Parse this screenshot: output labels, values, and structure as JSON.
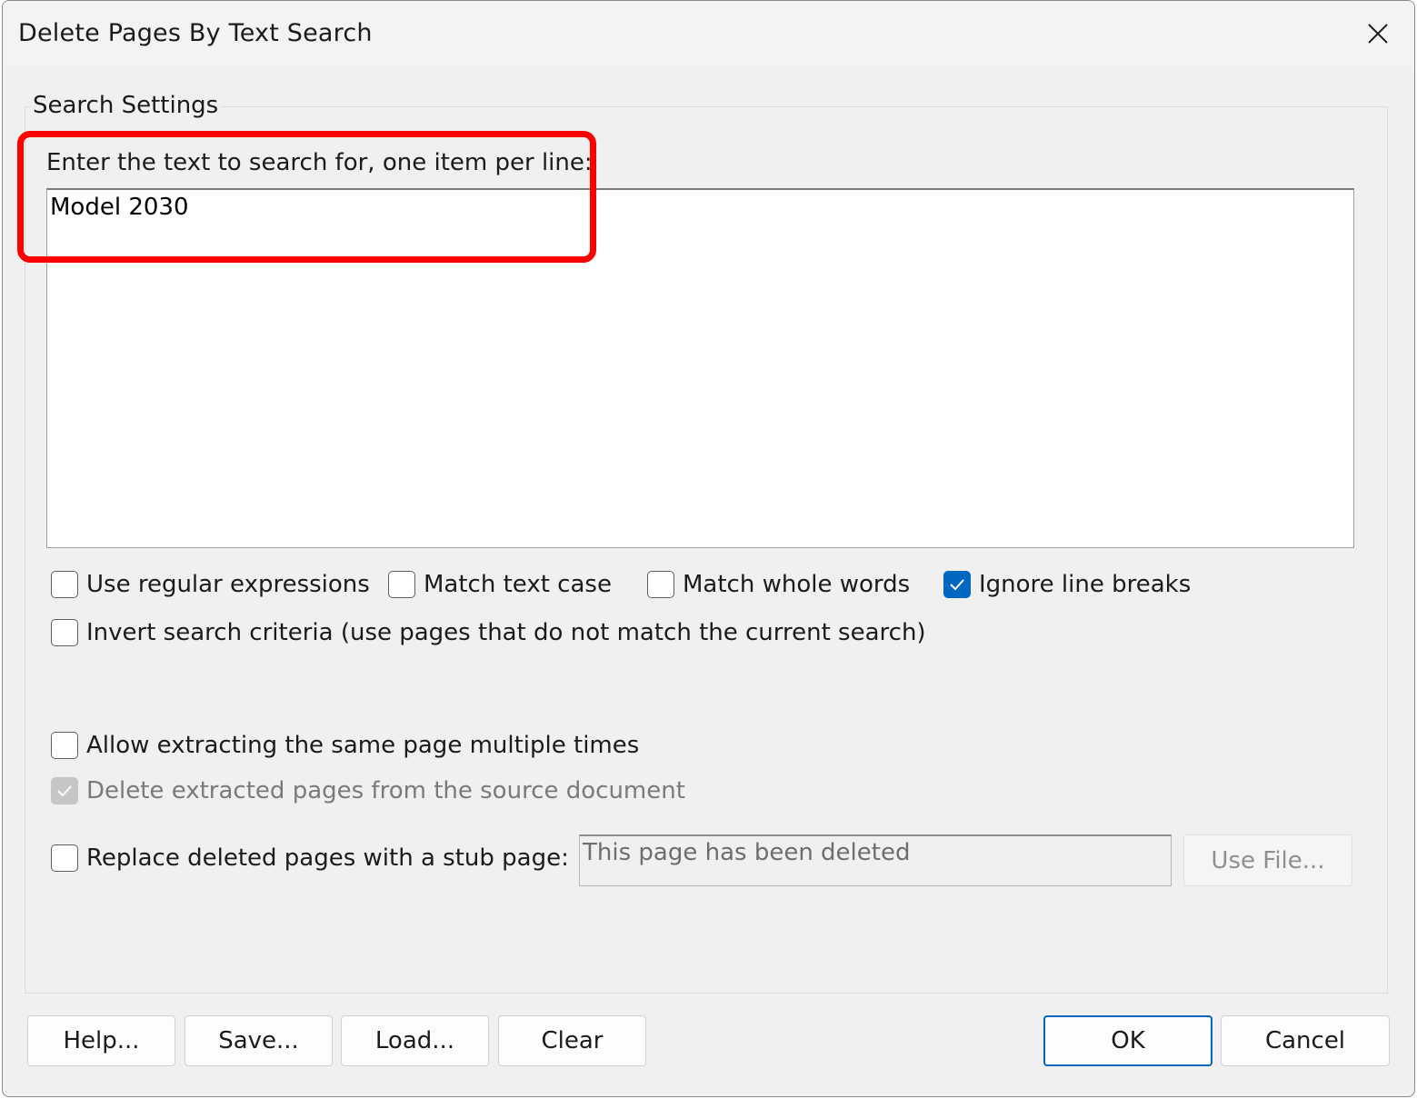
{
  "window": {
    "title": "Delete Pages By Text Search"
  },
  "search_settings": {
    "group_label": "Search Settings",
    "prompt": "Enter the text to search for, one item per line:",
    "search_text": "Model 2030"
  },
  "options": {
    "use_regex": {
      "label": "Use regular expressions",
      "checked": false
    },
    "match_case": {
      "label": "Match text case",
      "checked": false
    },
    "whole_words": {
      "label": "Match whole words",
      "checked": false
    },
    "ignore_line_breaks": {
      "label": "Ignore line breaks",
      "checked": true
    },
    "invert": {
      "label": "Invert search criteria (use pages that do not match the current search)",
      "checked": false
    },
    "allow_multiple": {
      "label": "Allow extracting the same page multiple times",
      "checked": false
    },
    "delete_extracted": {
      "label": "Delete extracted pages from the source document",
      "checked": true,
      "disabled": true
    },
    "replace_stub": {
      "label": "Replace deleted pages with a stub page:",
      "checked": false
    }
  },
  "stub": {
    "text": "This page has been deleted",
    "use_file_label": "Use File..."
  },
  "buttons": {
    "help": "Help...",
    "save": "Save...",
    "load": "Load...",
    "clear": "Clear",
    "ok": "OK",
    "cancel": "Cancel"
  },
  "colors": {
    "accent": "#0067c0",
    "highlight": "#ff0000"
  }
}
